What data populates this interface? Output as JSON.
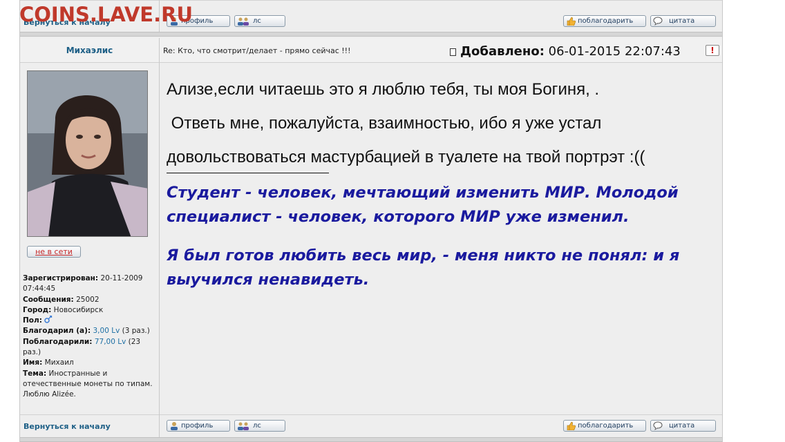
{
  "watermark": "COINS.LAVE.RU",
  "nav": {
    "back_to_top": "Вернуться к началу"
  },
  "buttons": {
    "profile": "профиль",
    "pm": "лс",
    "thanks": "поблагодарить",
    "quote": "цитата"
  },
  "post": {
    "author": "Михаэлис",
    "subject": "Re: Кто, что смотрит/делает - прямо сейчас !!!",
    "added_label": "Добавлено:",
    "added_datetime": "06-01-2015 22:07:43",
    "report_glyph": "!",
    "lines": [
      "Ализе,если читаешь это я люблю тебя, ты моя Богиня, .",
      " Ответь мне, пожалуйста, взаимностью, ибо я уже устал",
      "довольствоваться мастурбацией в туалете на твой портрэт :(("
    ],
    "signature_1": "Студент - человек, мечтающий изменить МИР. Молодой специалист - человек, которого МИР уже изменил.",
    "signature_2": "Я был готов любить весь мир, - меня никто не понял: и я выучился ненавидеть."
  },
  "user": {
    "status_button": "не в сети",
    "registered_label": "Зарегистрирован:",
    "registered_value": "20-11-2009 07:44:45",
    "messages_label": "Сообщения:",
    "messages_value": "25002",
    "city_label": "Город:",
    "city_value": "Новосибирск",
    "gender_label": "Пол:",
    "gender_icon": "male-female-icon",
    "thanked_label": "Благодарил (а):",
    "thanked_value": "3,00 Lv",
    "thanked_count": "(3 раз.)",
    "was_thanked_label": "Поблагодарили:",
    "was_thanked_value": "77,00 Lv",
    "was_thanked_count": "(23 раз.)",
    "name_label": "Имя:",
    "name_value": "Михаил",
    "theme_label": "Тема:",
    "theme_value": "Иностранные и отечественные монеты по типам. Люблю Alizée."
  },
  "colors": {
    "link": "#1d5f86",
    "signature": "#1a1a9e",
    "watermark": "#c0392b"
  }
}
